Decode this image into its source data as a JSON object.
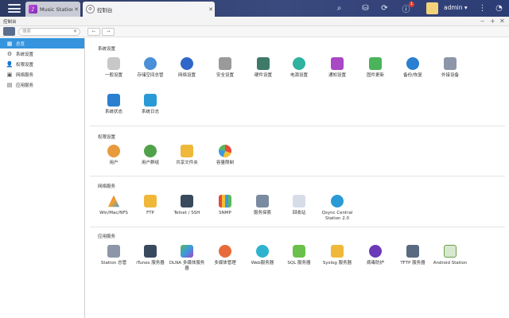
{
  "tabs": [
    {
      "label": "Music Station ..."
    },
    {
      "label": "控制台"
    }
  ],
  "top_right": {
    "badge_info": "1",
    "user": "admin"
  },
  "window_title": "控制台",
  "search": {
    "placeholder": "搜索"
  },
  "sidebar": {
    "items": [
      {
        "label": "总览"
      },
      {
        "label": "系统设置"
      },
      {
        "label": "权限设置"
      },
      {
        "label": "网络服务"
      },
      {
        "label": "应用服务"
      }
    ]
  },
  "sections": [
    {
      "title": "系统设置",
      "items": [
        {
          "label": "一般设置"
        },
        {
          "label": "存储空间总管"
        },
        {
          "label": "网络设置"
        },
        {
          "label": "安全设置"
        },
        {
          "label": "硬件设置"
        },
        {
          "label": "电源设置"
        },
        {
          "label": "通知设置"
        },
        {
          "label": "固件更新"
        },
        {
          "label": "备份/恢复"
        },
        {
          "label": "外接设备"
        },
        {
          "label": "系统状态"
        },
        {
          "label": "系统日志"
        }
      ]
    },
    {
      "title": "权限设置",
      "items": [
        {
          "label": "用户"
        },
        {
          "label": "用户群组"
        },
        {
          "label": "共享文件夹"
        },
        {
          "label": "容量限制"
        }
      ]
    },
    {
      "title": "网络服务",
      "items": [
        {
          "label": "Win/Mac/NFS"
        },
        {
          "label": "FTP"
        },
        {
          "label": "Telnet / SSH"
        },
        {
          "label": "SNMP"
        },
        {
          "label": "服务探索"
        },
        {
          "label": "回收站"
        },
        {
          "label": "Qsync Central Station 2.0"
        }
      ]
    },
    {
      "title": "应用服务",
      "items": [
        {
          "label": "Station 总管"
        },
        {
          "label": "iTunes 服务器"
        },
        {
          "label": "DLNA 多媒体服务器"
        },
        {
          "label": "多媒体管理"
        },
        {
          "label": "Web服务器"
        },
        {
          "label": "SQL 服务器"
        },
        {
          "label": "Syslog 服务器"
        },
        {
          "label": "病毒防护"
        },
        {
          "label": "TFTP 服务器"
        },
        {
          "label": "Android Station"
        }
      ]
    }
  ],
  "colors": {
    "accent": "#3594dd",
    "topbar": "#2d3a63"
  }
}
